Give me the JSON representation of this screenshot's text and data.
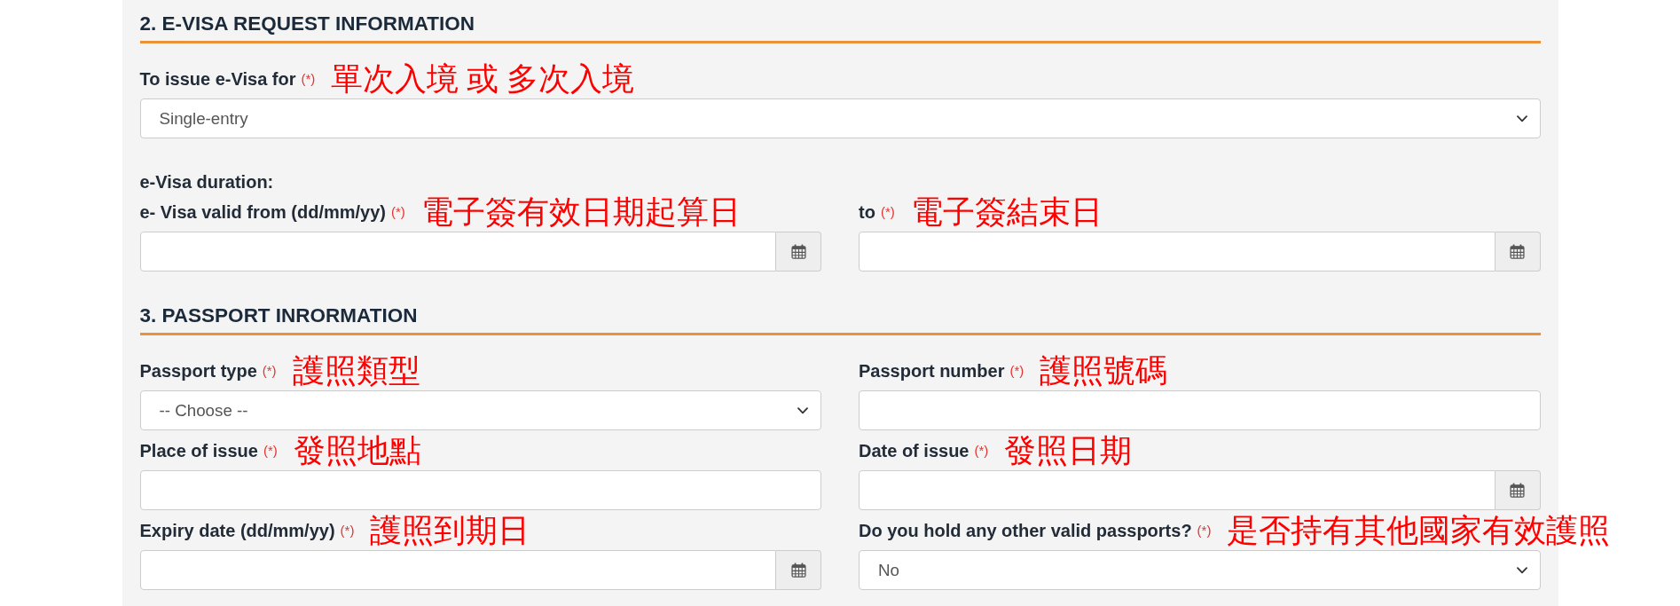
{
  "sections": [
    {
      "title": "2. E-VISA REQUEST INFORMATION",
      "rows": [
        {
          "fields": [
            {
              "label": "To issue e-Visa for",
              "required_mark": "(*)",
              "note": "單次入境 或 多次入境",
              "kind": "select",
              "value": "Single-entry"
            }
          ]
        },
        {
          "caption": "e-Visa duration:",
          "fields": [
            {
              "label": "e- Visa valid from (dd/mm/yy)",
              "required_mark": "(*)",
              "note": "電子簽有效日期起算日",
              "kind": "date"
            },
            {
              "label": "to",
              "required_mark": "(*)",
              "note": "電子簽結束日",
              "kind": "date"
            }
          ]
        }
      ]
    },
    {
      "title": "3. PASSPORT INRORMATION",
      "rows": [
        {
          "fields": [
            {
              "label": "Passport type",
              "required_mark": "(*)",
              "note": "護照類型",
              "kind": "select",
              "value": "-- Choose --"
            },
            {
              "label": "Passport number",
              "required_mark": "(*)",
              "note": "護照號碼",
              "kind": "text"
            }
          ]
        },
        {
          "fields": [
            {
              "label": "Place of issue",
              "required_mark": "(*)",
              "note": "發照地點",
              "kind": "text"
            },
            {
              "label": "Date of issue",
              "required_mark": "(*)",
              "note": "發照日期",
              "kind": "date"
            }
          ]
        },
        {
          "fields": [
            {
              "label": "Expiry date (dd/mm/yy)",
              "required_mark": "(*)",
              "note": "護照到期日",
              "kind": "date"
            },
            {
              "label": "Do you hold any other valid passports?",
              "required_mark": "(*)",
              "note": "是否持有其他國家有效護照",
              "kind": "select",
              "value": "No"
            }
          ]
        }
      ]
    }
  ]
}
